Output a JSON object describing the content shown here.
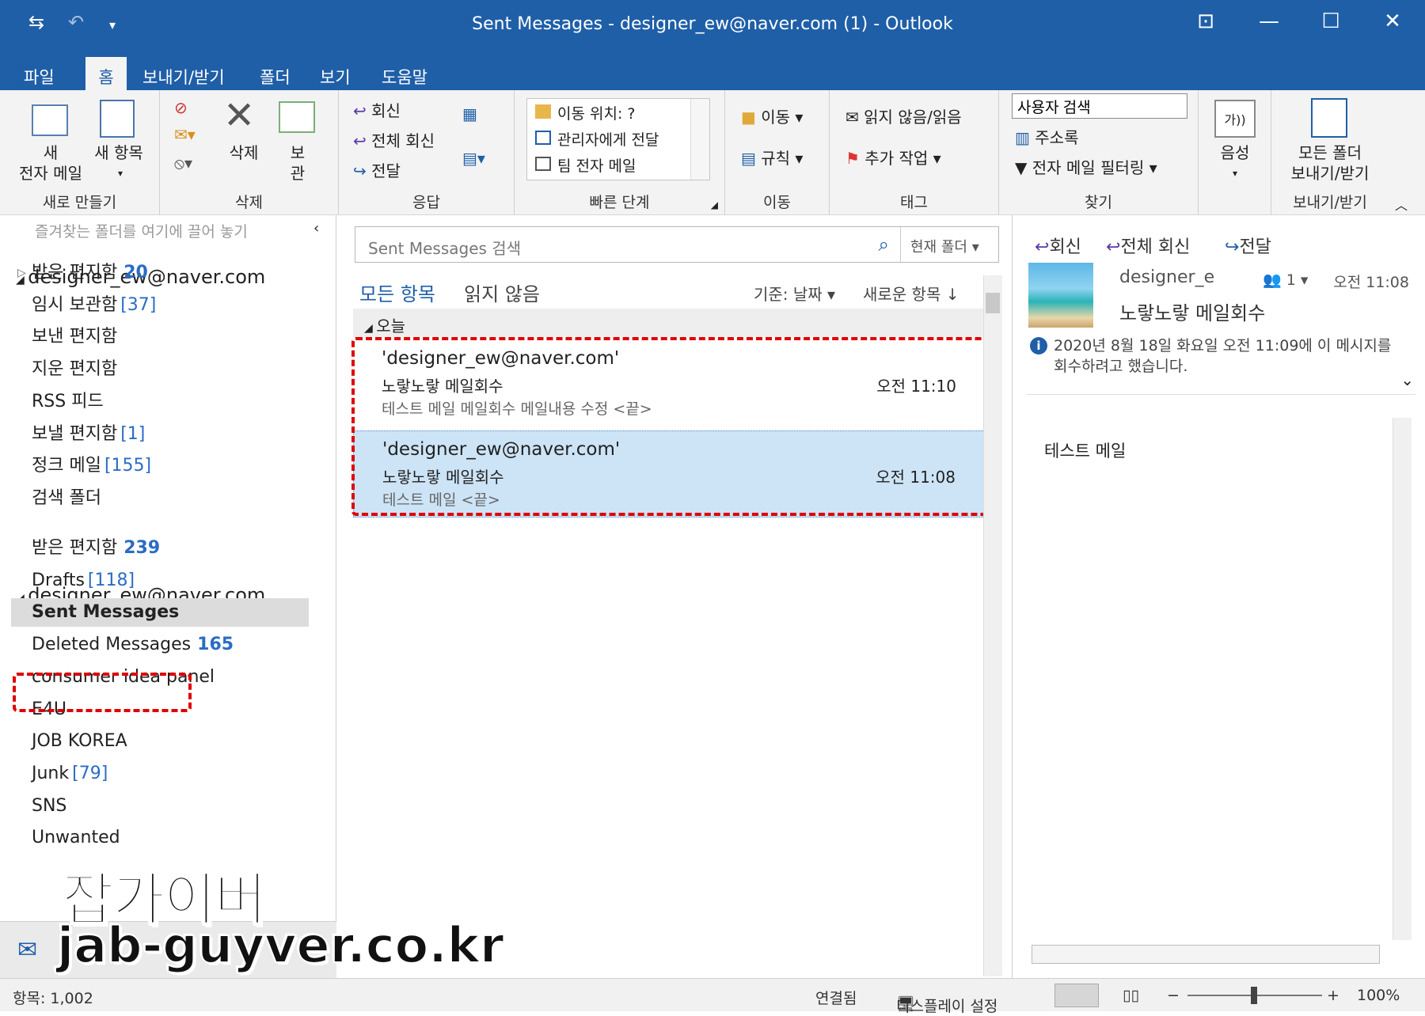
{
  "window": {
    "title": "Sent Messages - designer_ew@naver.com (1)  -  Outlook"
  },
  "tabs": [
    "파일",
    "홈",
    "보내기/받기",
    "폴더",
    "보기",
    "도움말"
  ],
  "ribbon": {
    "new_email": "새\n전자 메일",
    "new_items": "새 항목",
    "group_new": "새로 만들기",
    "delete": "삭제",
    "archive": "보\n관",
    "group_delete": "삭제",
    "reply": "회신",
    "reply_all": "전체 회신",
    "forward": "전달",
    "group_respond": "응답",
    "quicksteps": [
      "이동 위치: ?",
      "관리자에게 전달",
      "팀 전자 메일"
    ],
    "group_quicksteps": "빠른 단계",
    "move": "이동",
    "rules": "규칙",
    "group_move": "이동",
    "unread_read": "읽지 않음/읽음",
    "followup": "추가 작업",
    "group_tags": "태그",
    "search_people": "사용자 검색",
    "address_book": "주소록",
    "filter_email": "전자 메일 필터링",
    "group_find": "찾기",
    "speech": "음성",
    "send_receive_all": "모든 폴더\n보내기/받기",
    "group_send_receive": "보내기/받기"
  },
  "nav": {
    "favorites_hint": "즐겨찾는 폴더를 여기에 끌어 놓기",
    "account1": "designer_ew@naver.com",
    "account1_folders": [
      {
        "name": "받은 편지함",
        "count": "20",
        "style": "bold"
      },
      {
        "name": "임시 보관함",
        "count": "[37]",
        "style": "bracket"
      },
      {
        "name": "보낸 편지함",
        "count": "",
        "style": ""
      },
      {
        "name": "지운 편지함",
        "count": "",
        "style": ""
      },
      {
        "name": "RSS 피드",
        "count": "",
        "style": ""
      },
      {
        "name": "보낼 편지함",
        "count": "[1]",
        "style": "bracket"
      },
      {
        "name": "정크 메일",
        "count": "[155]",
        "style": "bracket"
      },
      {
        "name": "검색 폴더",
        "count": "",
        "style": ""
      }
    ],
    "account2": "designer_ew@naver.com...",
    "account2_folders": [
      {
        "name": "받은 편지함",
        "count": "239",
        "style": "bold"
      },
      {
        "name": "Drafts",
        "count": "[118]",
        "style": "bracket"
      },
      {
        "name": "Sent Messages",
        "count": "",
        "style": "selected"
      },
      {
        "name": "Deleted Messages",
        "count": "165",
        "style": "bold"
      },
      {
        "name": "consumer idea panel",
        "count": "",
        "style": ""
      },
      {
        "name": "E4U",
        "count": "",
        "style": ""
      },
      {
        "name": "JOB KOREA",
        "count": "",
        "style": ""
      },
      {
        "name": "Junk",
        "count": "[79]",
        "style": "bracket"
      },
      {
        "name": "SNS",
        "count": "",
        "style": ""
      },
      {
        "name": "Unwanted",
        "count": "",
        "style": ""
      }
    ]
  },
  "list": {
    "search_placeholder": "Sent Messages 검색",
    "scope": "현재 폴더",
    "filter_all": "모든 항목",
    "filter_unread": "읽지 않음",
    "sort_by": "기준: 날짜",
    "sort_order": "새로운 항목 ↓",
    "group_today": "오늘",
    "messages": [
      {
        "from": "'designer_ew@naver.com'",
        "subject": "노랗노랗 메일회수",
        "time": "오전 11:10",
        "preview": "테스트 메일  메일회수 메일내용 수정 <끝>"
      },
      {
        "from": "'designer_ew@naver.com'",
        "subject": "노랗노랗 메일회수",
        "time": "오전 11:08",
        "preview": "테스트 메일 <끝>"
      }
    ]
  },
  "reading": {
    "reply": "회신",
    "reply_all": "전체 회신",
    "forward": "전달",
    "sender": "designer_e",
    "people": "1",
    "time": "오전 11:08",
    "subject": "노랗노랗 메일회수",
    "info": "2020년 8월 18일 화요일 오전 11:09에 이 메시지를 회수하려고 했습니다.",
    "body": "테스트 메일"
  },
  "status": {
    "items": "항목: 1,002",
    "connected": "연결됨",
    "display_settings": "디스플레이 설정",
    "zoom": "100%"
  },
  "watermark": {
    "line1": "잡가이버",
    "line2": "jab-guyver.co.kr"
  }
}
